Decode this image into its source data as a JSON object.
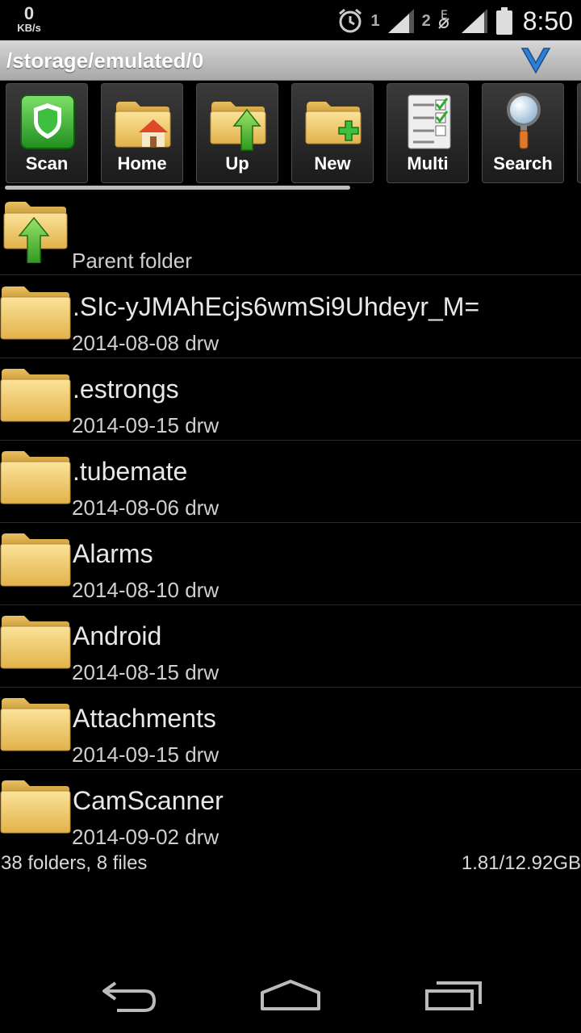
{
  "status_bar": {
    "speed_value": "0",
    "speed_unit": "KB/s",
    "sim1": "1",
    "sim2": "2",
    "time": "8:50"
  },
  "path_bar": {
    "path": "/storage/emulated/0"
  },
  "toolbar": {
    "buttons": [
      {
        "label": "Scan",
        "icon": "shield-icon"
      },
      {
        "label": "Home",
        "icon": "home-folder-icon"
      },
      {
        "label": "Up",
        "icon": "up-folder-icon"
      },
      {
        "label": "New",
        "icon": "new-folder-icon"
      },
      {
        "label": "Multi",
        "icon": "checklist-icon"
      },
      {
        "label": "Search",
        "icon": "magnifier-icon"
      }
    ]
  },
  "list": {
    "parent_label": "Parent folder",
    "items": [
      {
        "name": ".SIc-yJMAhEcjs6wmSi9Uhdeyr_M=",
        "meta": "2014-08-08 drw"
      },
      {
        "name": ".estrongs",
        "meta": "2014-09-15 drw"
      },
      {
        "name": ".tubemate",
        "meta": "2014-08-06 drw"
      },
      {
        "name": "Alarms",
        "meta": "2014-08-10 drw"
      },
      {
        "name": "Android",
        "meta": "2014-08-15 drw"
      },
      {
        "name": "Attachments",
        "meta": "2014-09-15 drw"
      },
      {
        "name": "CamScanner",
        "meta": "2014-09-02 drw"
      }
    ]
  },
  "summary": {
    "counts": "38 folders, 8 files",
    "storage": "1.81/12.92GB"
  },
  "colors": {
    "folder": "#f2cc6a",
    "background": "#000000",
    "path_bar": "#bdbdbd",
    "accent_blue": "#2e7fd6",
    "accent_green": "#3fbf3f"
  }
}
